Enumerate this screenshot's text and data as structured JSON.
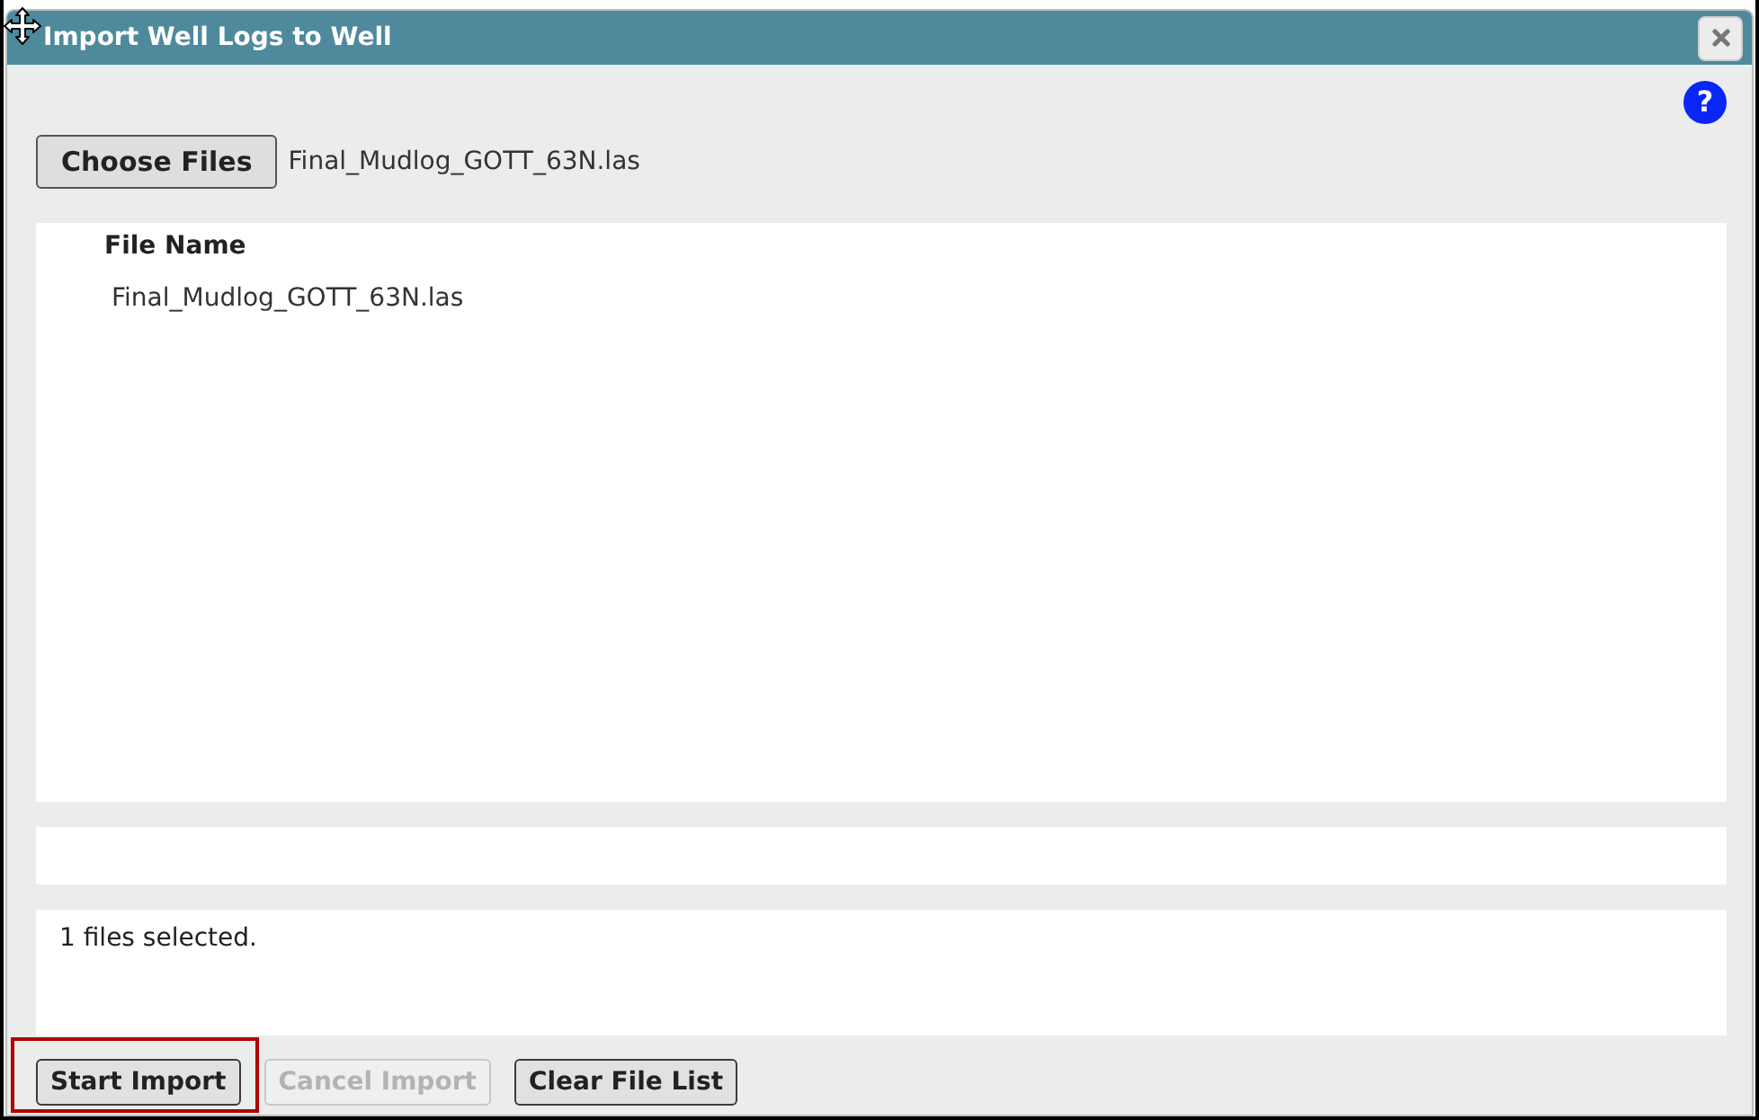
{
  "window": {
    "title": "Import Well Logs to Well"
  },
  "help": {
    "label": "?"
  },
  "file_picker": {
    "button": "Choose Files",
    "chosen_file": "Final_Mudlog_GOTT_63N.las"
  },
  "file_table": {
    "columns": [
      "File Name"
    ],
    "rows": [
      [
        "Final_Mudlog_GOTT_63N.las"
      ]
    ]
  },
  "status": {
    "message": "1 files selected."
  },
  "buttons": [
    {
      "label": "Start Import",
      "disabled": false,
      "highlighted": true
    },
    {
      "label": "Cancel Import",
      "disabled": true,
      "highlighted": false
    },
    {
      "label": "Clear File List",
      "disabled": false,
      "highlighted": false
    }
  ]
}
